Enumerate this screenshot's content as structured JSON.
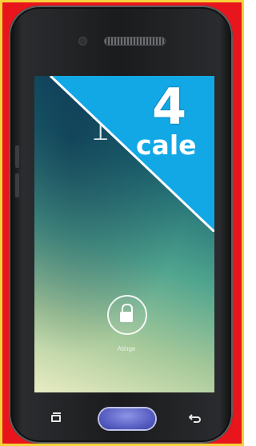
{
  "screen": {
    "clock_text": "11",
    "lock_hint": "Atinge"
  },
  "banner": {
    "number": "4",
    "word": "cale"
  },
  "colors": {
    "frame_red": "#e8161c",
    "frame_yellow": "#f7d23a",
    "banner_blue": "#12a8e6",
    "home_button": "#5960c4"
  },
  "icons": {
    "lock": "padlock-icon",
    "recent": "recent-apps-icon",
    "back": "back-arrow-icon"
  }
}
